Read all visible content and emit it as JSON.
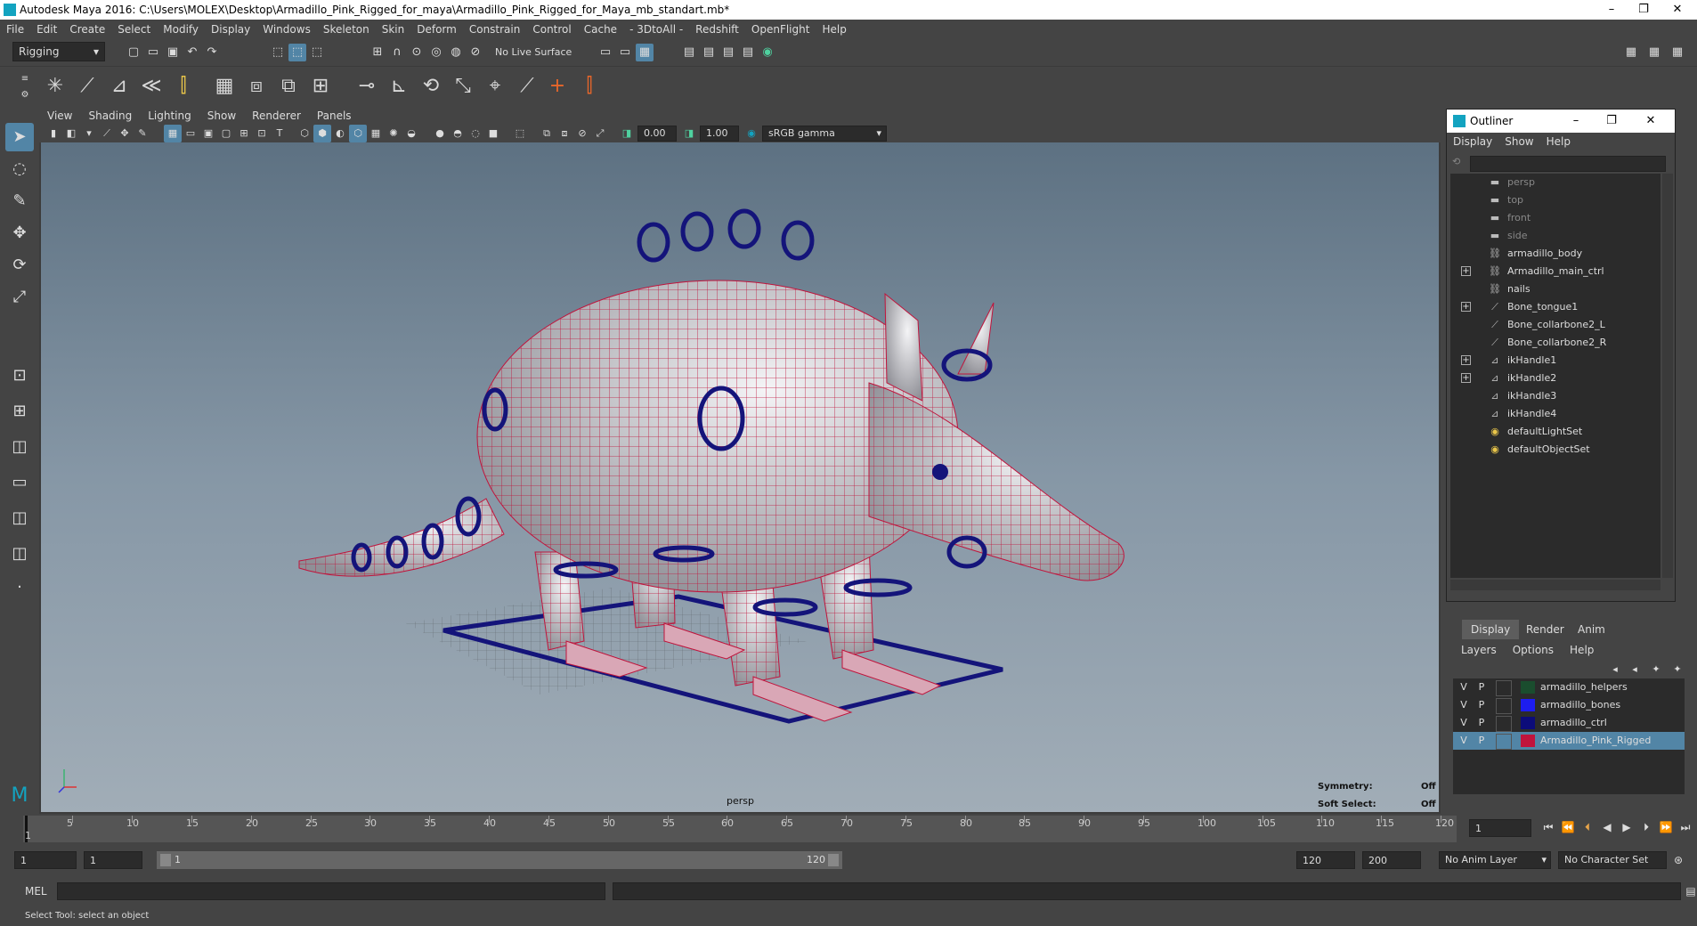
{
  "window": {
    "title": "Autodesk Maya 2016: C:\\Users\\MOLEX\\Desktop\\Armadillo_Pink_Rigged_for_maya\\Armadillo_Pink_Rigged_for_Maya_mb_standart.mb*",
    "minimize": "–",
    "restore": "❐",
    "close": "✕"
  },
  "menubar": [
    "File",
    "Edit",
    "Create",
    "Select",
    "Modify",
    "Display",
    "Windows",
    "Skeleton",
    "Skin",
    "Deform",
    "Constrain",
    "Control",
    "Cache",
    "- 3DtoAll -",
    "Redshift",
    "OpenFlight",
    "Help"
  ],
  "statusline": {
    "menuset": "Rigging",
    "live_surface": "No Live Surface"
  },
  "viewport": {
    "menu": [
      "View",
      "Shading",
      "Lighting",
      "Show",
      "Renderer",
      "Panels"
    ],
    "near_value": "0.00",
    "far_value": "1.00",
    "color_space": "sRGB gamma",
    "camera": "persp",
    "symmetry_label": "Symmetry:",
    "symmetry_value": "Off",
    "soft_select_label": "Soft Select:",
    "soft_select_value": "Off"
  },
  "outliner": {
    "title": "Outliner",
    "menu": [
      "Display",
      "Show",
      "Help"
    ],
    "items": [
      {
        "label": "persp",
        "icon": "camera-icon",
        "expand": false,
        "dim": true
      },
      {
        "label": "top",
        "icon": "camera-icon",
        "expand": false,
        "dim": true
      },
      {
        "label": "front",
        "icon": "camera-icon",
        "expand": false,
        "dim": true
      },
      {
        "label": "side",
        "icon": "camera-icon",
        "expand": false,
        "dim": true
      },
      {
        "label": "armadillo_body",
        "icon": "mesh-icon",
        "expand": false,
        "dim": false
      },
      {
        "label": "Armadillo_main_ctrl",
        "icon": "mesh-icon",
        "expand": true,
        "dim": false
      },
      {
        "label": "nails",
        "icon": "mesh-icon",
        "expand": false,
        "dim": false
      },
      {
        "label": "Bone_tongue1",
        "icon": "joint-icon",
        "expand": true,
        "dim": false
      },
      {
        "label": "Bone_collarbone2_L",
        "icon": "joint-icon",
        "expand": false,
        "dim": false
      },
      {
        "label": "Bone_collarbone2_R",
        "icon": "joint-icon",
        "expand": false,
        "dim": false
      },
      {
        "label": "ikHandle1",
        "icon": "ik-handle-icon",
        "expand": true,
        "dim": false
      },
      {
        "label": "ikHandle2",
        "icon": "ik-handle-icon",
        "expand": true,
        "dim": false
      },
      {
        "label": "ikHandle3",
        "icon": "ik-handle-icon",
        "expand": false,
        "dim": false
      },
      {
        "label": "ikHandle4",
        "icon": "ik-handle-icon",
        "expand": false,
        "dim": false
      },
      {
        "label": "defaultLightSet",
        "icon": "set-icon",
        "expand": false,
        "dim": false
      },
      {
        "label": "defaultObjectSet",
        "icon": "set-icon",
        "expand": false,
        "dim": false
      }
    ]
  },
  "layers": {
    "tabs": [
      "Display",
      "Render",
      "Anim"
    ],
    "menu": [
      "Layers",
      "Options",
      "Help"
    ],
    "visible_flag": "V",
    "playback_flag": "P",
    "rows": [
      {
        "name": "armadillo_helpers",
        "color": "#1a4d2e",
        "selected": false
      },
      {
        "name": "armadillo_bones",
        "color": "#1d1df0",
        "selected": false
      },
      {
        "name": "armadillo_ctrl",
        "color": "#0c0c7a",
        "selected": false
      },
      {
        "name": "Armadillo_Pink_Rigged",
        "color": "#c0143c",
        "selected": true
      }
    ]
  },
  "timeline": {
    "ticks": [
      "5",
      "10",
      "15",
      "20",
      "25",
      "30",
      "35",
      "40",
      "45",
      "50",
      "55",
      "60",
      "65",
      "70",
      "75",
      "80",
      "85",
      "90",
      "95",
      "100",
      "105",
      "110",
      "115",
      "120"
    ],
    "start_label": "1",
    "current_frame": "1"
  },
  "range": {
    "start": "1",
    "playback_start": "1",
    "range_start_label": "1",
    "range_end_label": "120",
    "playback_end": "120",
    "end": "200",
    "anim_layer": "No Anim Layer",
    "character_set": "No Character Set"
  },
  "cmd": {
    "lang": "MEL"
  },
  "help": {
    "text": "Select Tool: select an object"
  },
  "colors": {
    "mesh_wire": "#c0143c",
    "ctrl": "#14147a",
    "accent": "#5285a6"
  }
}
